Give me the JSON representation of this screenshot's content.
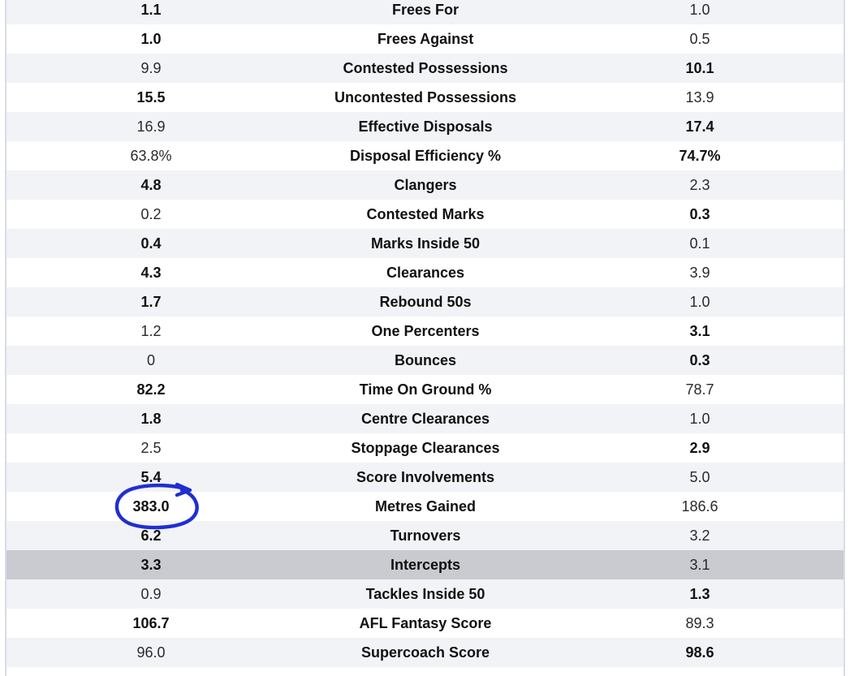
{
  "panel": {
    "name": "player-stat-comparison-table",
    "accent_blue": "#1f2fd2",
    "row_odd_color": "#f2f3f7",
    "row_even_color": "#ffffff",
    "row_highlight_color": "#c9cbd0",
    "edge_rule_color": "#d7dce8"
  },
  "annotation": {
    "type": "hand-drawn-circle-with-arrow",
    "color": "#1f2fd2",
    "targets_row": "Metres Gained",
    "targets_value": "383.0"
  },
  "table": {
    "columns": [
      "left_value",
      "stat",
      "right_value"
    ],
    "rows": [
      {
        "left": "1.1",
        "stat": "Frees For",
        "right": "1.0",
        "left_bold": true,
        "right_bold": false,
        "shade": "odd",
        "clipped_top": true
      },
      {
        "left": "1.0",
        "stat": "Frees Against",
        "right": "0.5",
        "left_bold": true,
        "right_bold": false,
        "shade": "even"
      },
      {
        "left": "9.9",
        "stat": "Contested Possessions",
        "right": "10.1",
        "left_bold": false,
        "right_bold": true,
        "shade": "odd"
      },
      {
        "left": "15.5",
        "stat": "Uncontested Possessions",
        "right": "13.9",
        "left_bold": true,
        "right_bold": false,
        "shade": "even"
      },
      {
        "left": "16.9",
        "stat": "Effective Disposals",
        "right": "17.4",
        "left_bold": false,
        "right_bold": true,
        "shade": "odd"
      },
      {
        "left": "63.8%",
        "stat": "Disposal Efficiency %",
        "right": "74.7%",
        "left_bold": false,
        "right_bold": true,
        "shade": "even"
      },
      {
        "left": "4.8",
        "stat": "Clangers",
        "right": "2.3",
        "left_bold": true,
        "right_bold": false,
        "shade": "odd"
      },
      {
        "left": "0.2",
        "stat": "Contested Marks",
        "right": "0.3",
        "left_bold": false,
        "right_bold": true,
        "shade": "even"
      },
      {
        "left": "0.4",
        "stat": "Marks Inside 50",
        "right": "0.1",
        "left_bold": true,
        "right_bold": false,
        "shade": "odd"
      },
      {
        "left": "4.3",
        "stat": "Clearances",
        "right": "3.9",
        "left_bold": true,
        "right_bold": false,
        "shade": "even"
      },
      {
        "left": "1.7",
        "stat": "Rebound 50s",
        "right": "1.0",
        "left_bold": true,
        "right_bold": false,
        "shade": "odd"
      },
      {
        "left": "1.2",
        "stat": "One Percenters",
        "right": "3.1",
        "left_bold": false,
        "right_bold": true,
        "shade": "even"
      },
      {
        "left": "0",
        "stat": "Bounces",
        "right": "0.3",
        "left_bold": false,
        "right_bold": true,
        "shade": "odd"
      },
      {
        "left": "82.2",
        "stat": "Time On Ground %",
        "right": "78.7",
        "left_bold": true,
        "right_bold": false,
        "shade": "even"
      },
      {
        "left": "1.8",
        "stat": "Centre Clearances",
        "right": "1.0",
        "left_bold": true,
        "right_bold": false,
        "shade": "odd"
      },
      {
        "left": "2.5",
        "stat": "Stoppage Clearances",
        "right": "2.9",
        "left_bold": false,
        "right_bold": true,
        "shade": "even"
      },
      {
        "left": "5.4",
        "stat": "Score Involvements",
        "right": "5.0",
        "left_bold": true,
        "right_bold": false,
        "shade": "odd"
      },
      {
        "left": "383.0",
        "stat": "Metres Gained",
        "right": "186.6",
        "left_bold": true,
        "right_bold": false,
        "shade": "even",
        "annotated": true
      },
      {
        "left": "6.2",
        "stat": "Turnovers",
        "right": "3.2",
        "left_bold": true,
        "right_bold": false,
        "shade": "odd"
      },
      {
        "left": "3.3",
        "stat": "Intercepts",
        "right": "3.1",
        "left_bold": true,
        "right_bold": false,
        "shade": "highlight"
      },
      {
        "left": "0.9",
        "stat": "Tackles Inside 50",
        "right": "1.3",
        "left_bold": false,
        "right_bold": true,
        "shade": "odd"
      },
      {
        "left": "106.7",
        "stat": "AFL Fantasy Score",
        "right": "89.3",
        "left_bold": true,
        "right_bold": false,
        "shade": "even"
      },
      {
        "left": "96.0",
        "stat": "Supercoach Score",
        "right": "98.6",
        "left_bold": false,
        "right_bold": true,
        "shade": "odd",
        "clipped_bottom": true
      }
    ]
  }
}
